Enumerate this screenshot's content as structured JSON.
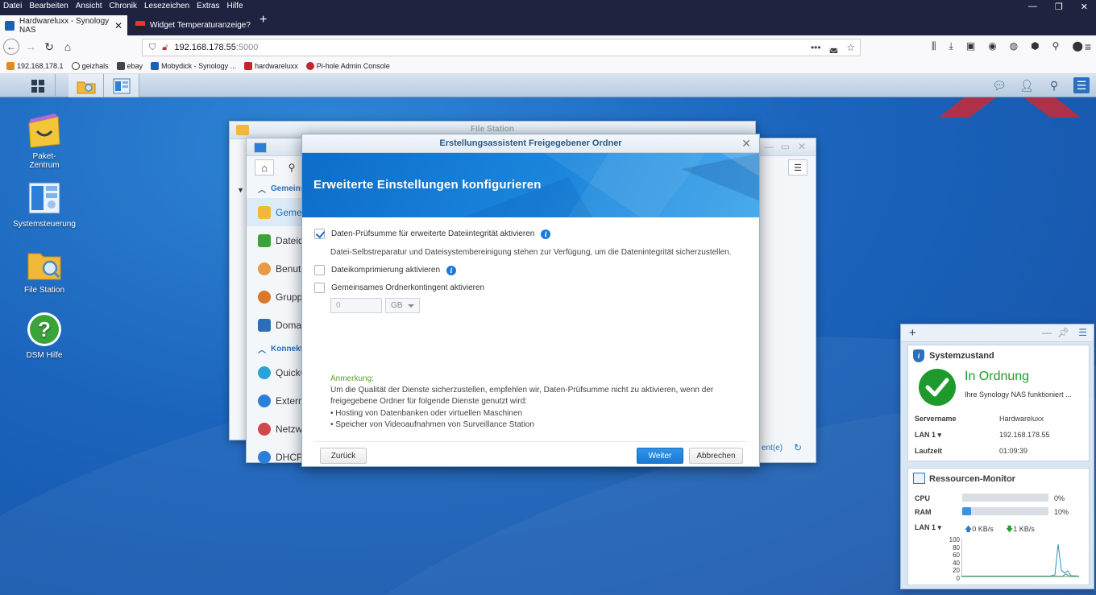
{
  "browser": {
    "menu": [
      "Datei",
      "Bearbeiten",
      "Ansicht",
      "Chronik",
      "Lesezeichen",
      "Extras",
      "Hilfe"
    ],
    "tabs": [
      {
        "title": "Hardwareluxx - Synology NAS"
      },
      {
        "title": "Widget Temperaturanzeige?"
      }
    ],
    "url_host": "192.168.178.55",
    "url_port": ":5000",
    "bookmarks": [
      "192.168.178.1",
      "geizhals",
      "ebay",
      "Mobydick - Synology ...",
      "hardwareluxx",
      "Pi-hole Admin Console"
    ]
  },
  "desktop": {
    "icons": [
      {
        "label": "Paket-\nZentrum"
      },
      {
        "label": "Systemsteuerung"
      },
      {
        "label": "File Station"
      },
      {
        "label": "DSM Hilfe"
      }
    ]
  },
  "bg_window": {
    "title": "File Station",
    "section1": "Gemeins",
    "items1": [
      "Gemein",
      "Dateid",
      "Benutz",
      "Gruppe",
      "Domain"
    ],
    "section2": "Konnekt",
    "items2": [
      "QuickC",
      "Extern",
      "Netzwe",
      "DHCP-"
    ],
    "footer_link": "ent(e)"
  },
  "dialog": {
    "title": "Erstellungsassistent Freigegebener Ordner",
    "heading": "Erweiterte Einstellungen konfigurieren",
    "opt_checksum": "Daten-Prüfsumme für erweiterte Dateiintegrität aktivieren",
    "opt_checksum_checked": true,
    "checksum_desc": "Datei-Selbstreparatur und Dateisystembereinigung stehen zur Verfügung, um die Datenintegrität sicherzustellen.",
    "opt_compress": "Dateikomprimierung aktivieren",
    "opt_quota": "Gemeinsames Ordnerkontingent aktivieren",
    "quota_value": "0",
    "quota_unit": "GB",
    "note_label": "Anmerkung:",
    "note_line1": "Um die Qualität der Dienste sicherzustellen, empfehlen wir, Daten-Prüfsumme nicht zu aktivieren, wenn der",
    "note_line2": "freigegebene Ordner für folgende Dienste genutzt wird:",
    "note_bullet1": "Hosting von Datenbanken oder virtuellen Maschinen",
    "note_bullet2": "Speicher von Videoaufnahmen von Surveillance Station",
    "btn_back": "Zurück",
    "btn_next": "Weiter",
    "btn_cancel": "Abbrechen"
  },
  "system_status": {
    "title": "Systemzustand",
    "status": "In Ordnung",
    "status_desc": "Ihre Synology NAS funktioniert ...",
    "servername_label": "Servername",
    "servername": "Hardwareluxx",
    "lan_label": "LAN 1 ▾",
    "lan_ip": "192.168.178.55",
    "uptime_label": "Laufzeit",
    "uptime": "01:09:39"
  },
  "resource_monitor": {
    "title": "Ressourcen-Monitor",
    "cpu_label": "CPU",
    "cpu_pct": 0,
    "cpu_text": "0%",
    "ram_label": "RAM",
    "ram_pct": 10,
    "ram_text": "10%",
    "lan_label": "LAN 1 ▾",
    "up_rate": "0 KB/s",
    "down_rate": "1 KB/s",
    "y_ticks": [
      "100",
      "80",
      "60",
      "40",
      "20",
      "0"
    ]
  },
  "colors": {
    "accent": "#1a79d2",
    "ok_green": "#1e9a2c",
    "desktop": "#1b64bd"
  }
}
